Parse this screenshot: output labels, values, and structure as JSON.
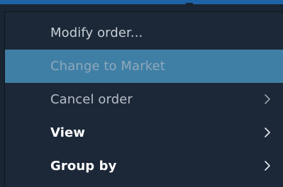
{
  "context_menu": {
    "items": [
      {
        "label": "Modify order...",
        "has_submenu": false,
        "state": "normal"
      },
      {
        "label": "Change to Market",
        "has_submenu": false,
        "state": "highlighted-disabled"
      },
      {
        "label": "Cancel order",
        "has_submenu": true,
        "state": "normal"
      },
      {
        "label": "View",
        "has_submenu": true,
        "state": "bold"
      },
      {
        "label": "Group by",
        "has_submenu": true,
        "state": "bold"
      }
    ]
  },
  "colors": {
    "menu_background": "#1c2838",
    "highlight": "#3f7fa5",
    "accent": "#1e63a7"
  },
  "icons": {
    "submenu": "chevron-right-icon"
  }
}
